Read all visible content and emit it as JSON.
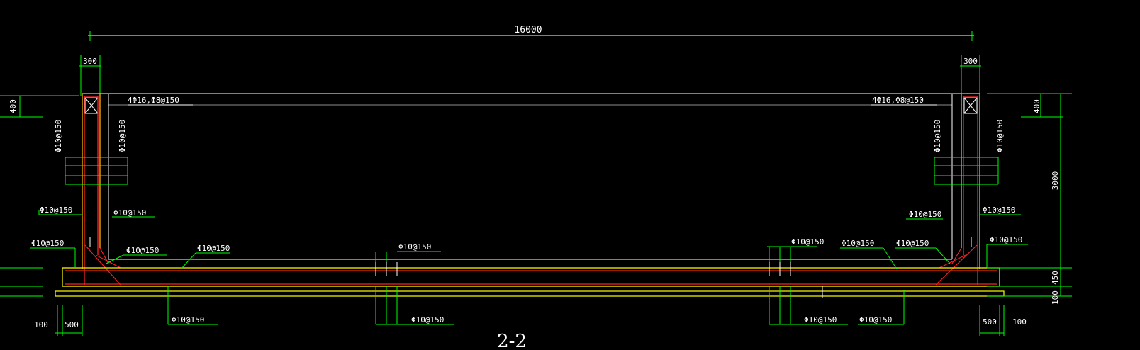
{
  "drawing": {
    "title": "2-2",
    "colors": {
      "background": "#000000",
      "dimension": "#00ff00",
      "rebar": "#ff2020",
      "outline": "#ffffff",
      "slab": "#ffff00"
    },
    "dimensions": {
      "total_width": "16000",
      "left_wall_thickness": "300",
      "right_wall_thickness": "300",
      "left_top_height": "400",
      "right_top_height": "400",
      "wall_height": "3000",
      "slab_thickness": "450",
      "bedding_thickness": "100",
      "left_bottom_offset": "100",
      "left_bottom_toe": "500",
      "right_bottom_toe": "500",
      "right_bottom_offset": "100"
    },
    "rebar_labels": {
      "left_top_beam": "4Φ16,Φ8@150",
      "right_top_beam": "4Φ16,Φ8@150",
      "left_wall_outer_vertical": "Φ10@150",
      "left_wall_inner_vertical": "Φ10@150",
      "right_wall_inner_vertical": "Φ10@150",
      "right_wall_outer_vertical": "Φ10@150",
      "left_wall_outer_horizontal": "Φ10@150",
      "left_wall_inner_horizontal": "Φ10@150",
      "right_wall_inner_horizontal": "Φ10@150",
      "right_wall_outer_horizontal": "Φ10@150",
      "left_footing_outer": "Φ10@150",
      "left_haunch": "Φ10@150",
      "left_slab_top": "Φ10@150",
      "center_slab_top": "Φ10@150",
      "right_slab_top_a": "Φ10@150",
      "right_slab_top_b": "Φ10@150",
      "right_haunch": "Φ10@150",
      "right_footing_outer": "Φ10@150",
      "left_slab_bottom": "Φ10@150",
      "center_slab_bottom": "Φ10@150",
      "right_slab_bottom_a": "Φ10@150",
      "right_slab_bottom_b": "Φ10@150"
    }
  }
}
